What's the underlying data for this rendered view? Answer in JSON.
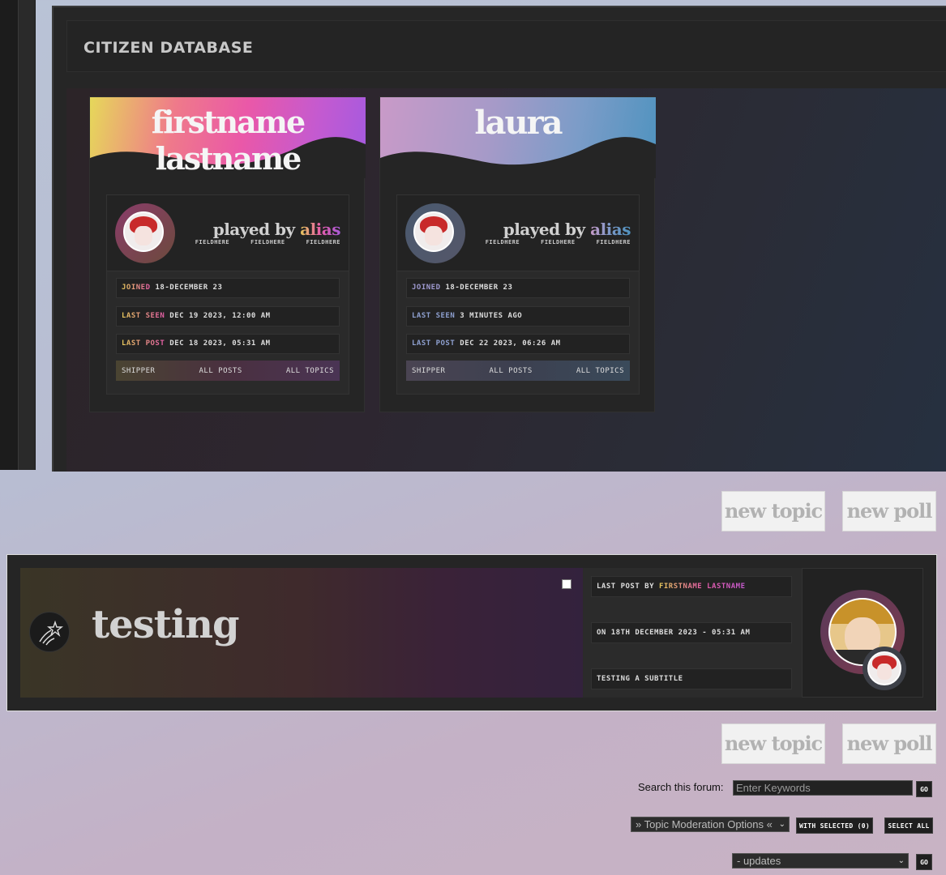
{
  "database": {
    "title": "CITIZEN DATABASE"
  },
  "cards": [
    {
      "name": "firstname lastname",
      "played_by_prefix": "played by",
      "played_by_name": "alias",
      "fields": [
        "FIELDHERE",
        "FIELDHERE",
        "FIELDHERE"
      ],
      "joined_label": "JOINED",
      "joined_value": "18-DECEMBER 23",
      "last_seen_label": "LAST SEEN",
      "last_seen_value": "DEC 19 2023, 12:00 AM",
      "last_post_label": "LAST POST",
      "last_post_value": "DEC 18 2023, 05:31 AM",
      "links": [
        "SHIPPER",
        "ALL POSTS",
        "ALL TOPICS"
      ]
    },
    {
      "name": "laura",
      "played_by_prefix": "played by",
      "played_by_name": "alias",
      "fields": [
        "FIELDHERE",
        "FIELDHERE",
        "FIELDHERE"
      ],
      "joined_label": "JOINED",
      "joined_value": "18-DECEMBER 23",
      "last_seen_label": "LAST SEEN",
      "last_seen_value": "3 MINUTES AGO",
      "last_post_label": "LAST POST",
      "last_post_value": "DEC 22 2023, 06:26 AM",
      "links": [
        "SHIPPER",
        "ALL POSTS",
        "ALL TOPICS"
      ]
    }
  ],
  "buttons": {
    "new_topic": "new topic",
    "new_poll": "new poll"
  },
  "topic": {
    "title": "testing",
    "last_post_by_label": "LAST POST BY",
    "last_post_by_name": "FIRSTNAME LASTNAME",
    "date": "ON 18TH DECEMBER 2023 - 05:31 AM",
    "subtitle": "TESTING A SUBTITLE",
    "icon": "shooting-star-icon"
  },
  "search": {
    "label": "Search this forum:",
    "placeholder": "Enter Keywords",
    "go": "GO"
  },
  "moderation": {
    "options_value": "» Topic Moderation Options «",
    "with_selected": "WITH SELECTED (0)",
    "select_all": "SELECT ALL"
  },
  "jump": {
    "value": "- updates",
    "go": "GO"
  },
  "colors": {
    "card1_gradient": [
      "#e2d25a",
      "#ea5fa0",
      "#a35ad8"
    ],
    "card2_gradient": [
      "#c89bc8",
      "#7a98c8",
      "#4f92bf"
    ]
  }
}
